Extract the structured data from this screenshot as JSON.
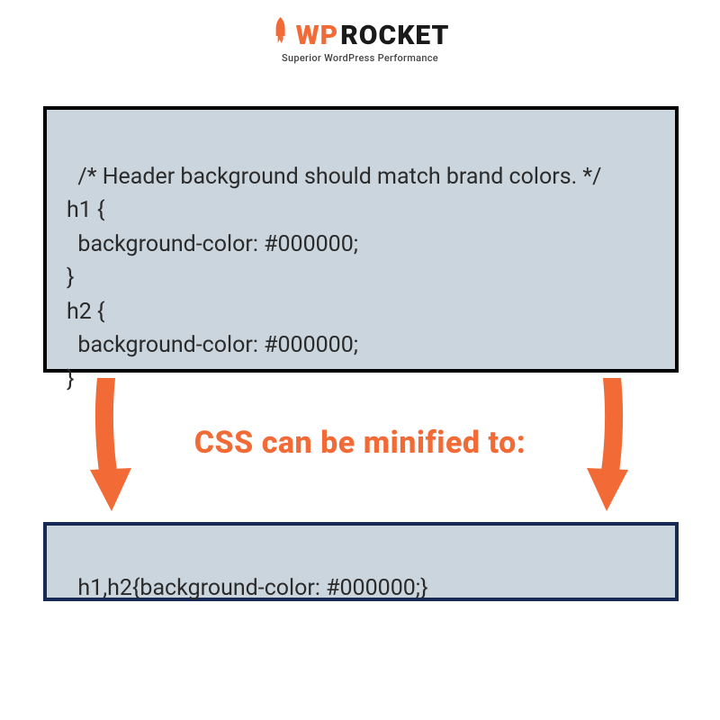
{
  "logo": {
    "wp": "WP",
    "rocket": " ROCKET",
    "tagline": "Superior WordPress Performance"
  },
  "code_before": "/* Header background should match brand colors. */\nh1 {\n  background-color: #000000;\n}\nh2 {\n  background-color: #000000;\n}",
  "caption": "CSS can be minified to:",
  "code_after": "h1,h2{background-color: #000000;}",
  "colors": {
    "accent": "#f26a36",
    "box_bg": "#cad5dd",
    "box1_border": "#000000",
    "box2_border": "#172a53"
  }
}
